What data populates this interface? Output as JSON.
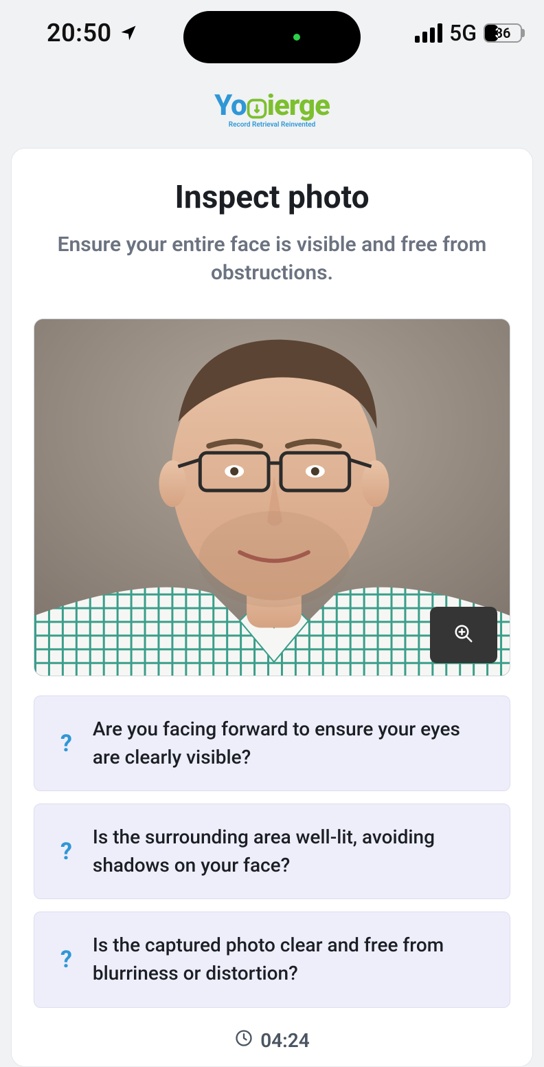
{
  "statusbar": {
    "time": "20:50",
    "network": "5G",
    "battery_pct": "36"
  },
  "logo": {
    "part1": "Yo",
    "part2": "ierge",
    "tagline": "Record Retrieval Reinvented"
  },
  "card": {
    "title": "Inspect photo",
    "subtitle": "Ensure your entire face is visible and free from obstructions."
  },
  "questions": [
    "Are you facing forward to ensure your eyes are clearly visible?",
    "Is the surrounding area well-lit, avoiding shadows on your face?",
    "Is the captured photo clear and free from blurriness or distortion?"
  ],
  "timer": "04:24"
}
